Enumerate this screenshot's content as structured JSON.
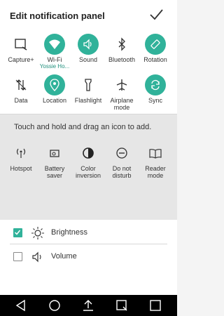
{
  "header": {
    "title": "Edit notification panel"
  },
  "active_tiles": [
    {
      "label": "Capture+",
      "icon": "capture-icon",
      "on": false
    },
    {
      "label": "Wi-Fi",
      "sub": "Yossie Ho...",
      "icon": "wifi-icon",
      "on": true
    },
    {
      "label": "Sound",
      "icon": "sound-icon",
      "on": true
    },
    {
      "label": "Bluetooth",
      "icon": "bluetooth-icon",
      "on": false
    },
    {
      "label": "Rotation",
      "icon": "rotation-icon",
      "on": true
    },
    {
      "label": "Data",
      "icon": "data-icon",
      "on": false
    },
    {
      "label": "Location",
      "icon": "location-icon",
      "on": true
    },
    {
      "label": "Flashlight",
      "icon": "flashlight-icon",
      "on": false
    },
    {
      "label": "Airplane mode",
      "line1": "Airplane",
      "line2": "mode",
      "icon": "airplane-icon",
      "on": false
    },
    {
      "label": "Sync",
      "icon": "sync-icon",
      "on": true
    }
  ],
  "inactive": {
    "hint": "Touch and hold and drag an icon to add.",
    "tiles": [
      {
        "line1": "Hotspot",
        "line2": "",
        "icon": "hotspot-icon"
      },
      {
        "line1": "Battery",
        "line2": "saver",
        "icon": "battery-saver-icon"
      },
      {
        "line1": "Color",
        "line2": "inversion",
        "icon": "color-inversion-icon"
      },
      {
        "line1": "Do not",
        "line2": "disturb",
        "icon": "do-not-disturb-icon"
      },
      {
        "line1": "Reader",
        "line2": "mode",
        "icon": "reader-mode-icon"
      }
    ]
  },
  "settings": [
    {
      "label": "Brightness",
      "checked": true,
      "icon": "brightness-icon"
    },
    {
      "label": "Volume",
      "checked": false,
      "icon": "volume-icon"
    }
  ],
  "navbar": [
    "back-icon",
    "home-icon",
    "share-icon",
    "dual-window-icon",
    "recents-icon"
  ],
  "colors": {
    "accent": "#30b29a",
    "navbar": "#000000",
    "inactive_bg": "#e6e6e6"
  }
}
